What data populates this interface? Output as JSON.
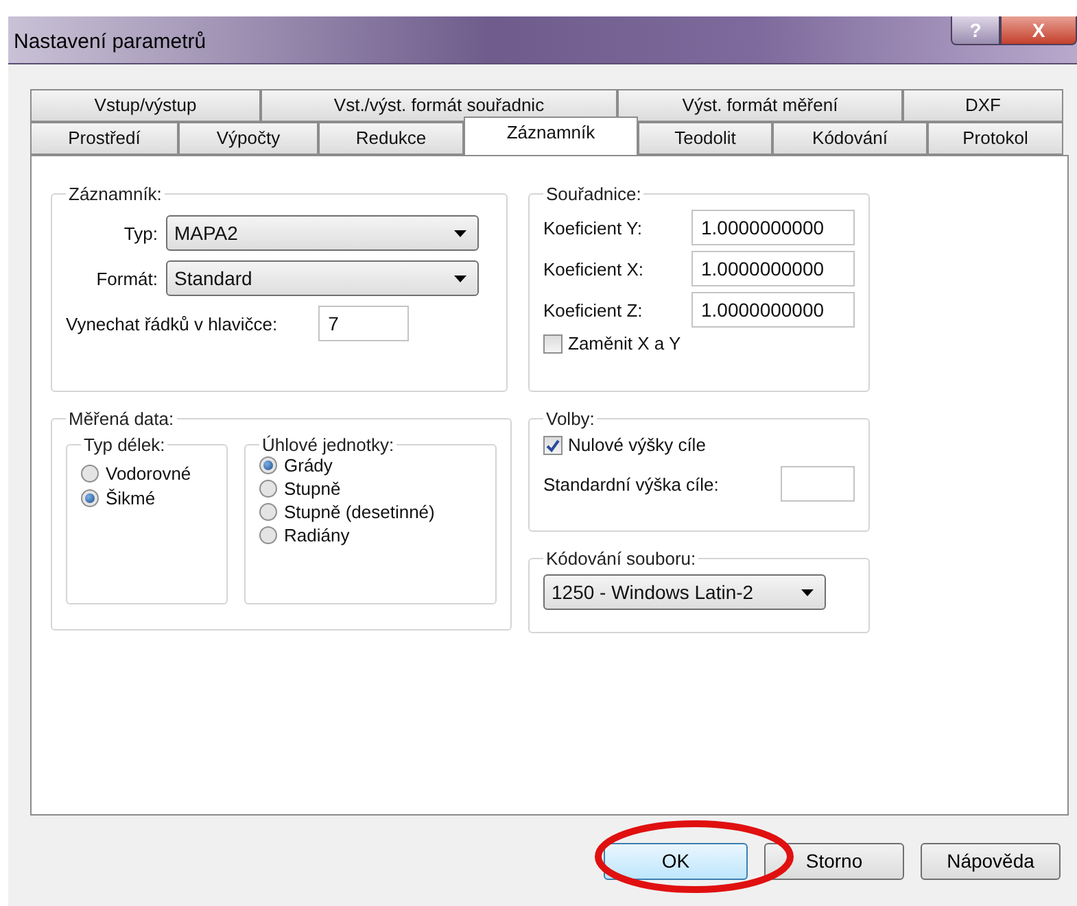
{
  "window": {
    "title": "Nastavení parametrů",
    "title_buttons": [
      {
        "kind": "help",
        "label": "?"
      },
      {
        "kind": "close",
        "label": "X"
      }
    ]
  },
  "tab_rows": [
    [
      {
        "label": "Vstup/výstup",
        "selected": false
      },
      {
        "label": "Vst./výst. formát souřadnic",
        "selected": false
      },
      {
        "label": "Výst. formát měření",
        "selected": false
      },
      {
        "label": "DXF",
        "selected": false
      }
    ],
    [
      {
        "label": "Prostředí",
        "selected": false
      },
      {
        "label": "Výpočty",
        "selected": false
      },
      {
        "label": "Redukce",
        "selected": false
      },
      {
        "label": "Záznamník",
        "selected": true
      },
      {
        "label": "Teodolit",
        "selected": false
      },
      {
        "label": "Kódování",
        "selected": false
      },
      {
        "label": "Protokol",
        "selected": false
      }
    ]
  ],
  "recorder": {
    "title": "Záznamník:",
    "type_label": "Typ:",
    "type_value": "MAPA2",
    "format_label": "Formát:",
    "format_value": "Standard",
    "skip_label": "Vynechat řádků v hlavičce:",
    "skip_value": "7"
  },
  "measured_data": {
    "title": "Měřená data:",
    "length_type": {
      "title": "Typ délek:",
      "options": [
        {
          "label": "Vodorovné",
          "selected": false
        },
        {
          "label": "Šikmé",
          "selected": true
        }
      ]
    },
    "angle_units": {
      "title": "Úhlové jednotky:",
      "options": [
        {
          "label": "Grády",
          "selected": true
        },
        {
          "label": "Stupně",
          "selected": false
        },
        {
          "label": "Stupně (desetinné)",
          "selected": false
        },
        {
          "label": "Radiány",
          "selected": false
        }
      ]
    }
  },
  "coordinates": {
    "title": "Souřadnice:",
    "coefficients": [
      {
        "label": "Koeficient Y:",
        "value": "1.0000000000"
      },
      {
        "label": "Koeficient X:",
        "value": "1.0000000000"
      },
      {
        "label": "Koeficient Z:",
        "value": "1.0000000000"
      }
    ],
    "swap": {
      "label": "Zaměnit X a Y",
      "checked": false
    }
  },
  "options": {
    "title": "Volby:",
    "zero_heights": {
      "label": "Nulové výšky cíle",
      "checked": true
    },
    "default_height_label": "Standardní výška cíle:"
  },
  "file_encoding": {
    "title": "Kódování souboru:",
    "value": "1250 - Windows Latin-2"
  },
  "buttons": [
    {
      "label": "OK",
      "highlighted": true
    },
    {
      "label": "Storno",
      "highlighted": false
    },
    {
      "label": "Nápověda",
      "highlighted": false
    }
  ]
}
